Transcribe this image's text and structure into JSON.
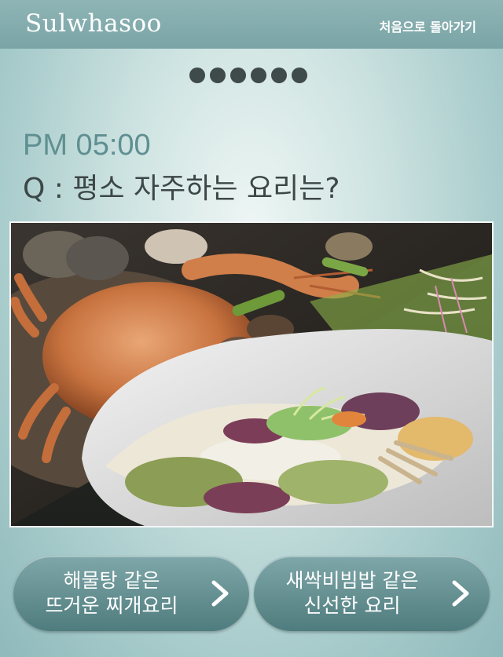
{
  "header": {
    "logo_text": "Sulwhasoo",
    "back_link": "처음으로 돌아가기"
  },
  "progress": {
    "total_steps": 6
  },
  "content": {
    "time": "PM 05:00",
    "question": "Q : 평소 자주하는 요리는?"
  },
  "photo": {
    "left_dish_icon": "seafood-stew-crab-icon",
    "right_dish_icon": "sprout-bibimbap-bowl-icon"
  },
  "choices": [
    {
      "line1": "해물탕 같은",
      "line2": "뜨거운 찌개요리"
    },
    {
      "line1": "새싹비빔밥 같은",
      "line2": "신선한 요리"
    }
  ],
  "colors": {
    "header_bg": "#7aa4a6",
    "accent_time": "#5f8f91",
    "question_text": "#3d4747",
    "button_bg": "#5f8b8d"
  }
}
